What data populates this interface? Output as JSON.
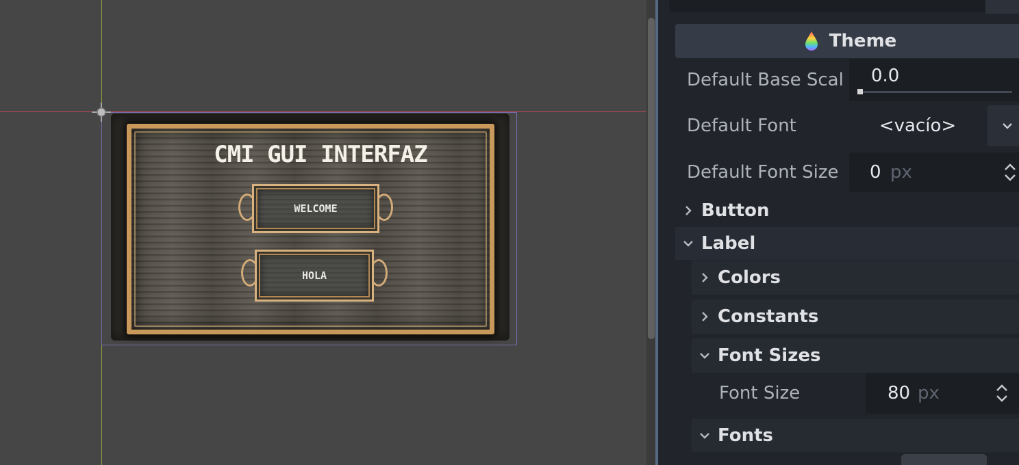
{
  "viewport": {
    "gui": {
      "title": "CMI GUI  INTERFAZ",
      "buttons": [
        {
          "label": "WELCOME"
        },
        {
          "label": "HOLA"
        }
      ]
    }
  },
  "inspector": {
    "theme_header": {
      "label": "Theme",
      "icon": "theme-drop-icon"
    },
    "properties": {
      "default_base_scale": {
        "label": "Default Base Scal",
        "value": "0.0",
        "slider_fraction": 0.0
      },
      "default_font": {
        "label": "Default Font",
        "value": "<vacío>"
      },
      "default_font_size": {
        "label": "Default Font Size",
        "value": "0",
        "unit": "px"
      }
    },
    "sections": {
      "button": {
        "label": "Button",
        "expanded": false
      },
      "label": {
        "label": "Label",
        "expanded": true
      },
      "colors": {
        "label": "Colors",
        "expanded": false
      },
      "constants": {
        "label": "Constants",
        "expanded": false
      },
      "font_sizes": {
        "label": "Font Sizes",
        "expanded": true
      },
      "fonts": {
        "label": "Fonts",
        "expanded": true
      }
    },
    "font_size": {
      "label": "Font Size",
      "value": "80",
      "unit": "px"
    }
  },
  "colors": {
    "viewport_bg": "#464646",
    "inspector_bg": "#21252b",
    "frame_gold": "#c9995c",
    "guide_vertical": "#8fa33a",
    "guide_horizontal": "#b84a50"
  }
}
